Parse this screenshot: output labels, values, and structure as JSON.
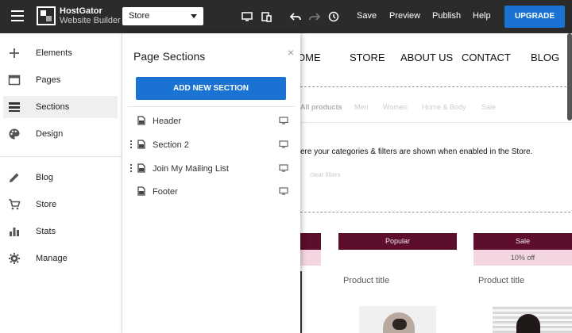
{
  "app": {
    "brand_line1": "HostGator",
    "brand_line2": "Website Builder",
    "page_select": "Store"
  },
  "toolbar": {
    "save": "Save",
    "preview": "Preview",
    "publish": "Publish",
    "help": "Help",
    "upgrade": "UPGRADE",
    "icons": [
      "desktop-icon",
      "mobile-icon",
      "undo-icon",
      "redo-icon",
      "history-icon"
    ]
  },
  "leftnav": {
    "items": [
      {
        "label": "Elements",
        "icon": "plus-icon"
      },
      {
        "label": "Pages",
        "icon": "browser-icon"
      },
      {
        "label": "Sections",
        "icon": "sections-icon",
        "active": true
      },
      {
        "label": "Design",
        "icon": "palette-icon"
      },
      {
        "label": "Blog",
        "icon": "pencil-icon"
      },
      {
        "label": "Store",
        "icon": "cart-icon"
      },
      {
        "label": "Stats",
        "icon": "bar-chart-icon"
      },
      {
        "label": "Manage",
        "icon": "gear-icon"
      }
    ]
  },
  "panel": {
    "title": "Page Sections",
    "close": "×",
    "add_button": "ADD NEW SECTION",
    "sections": [
      {
        "label": "Header",
        "draggable": false
      },
      {
        "label": "Section 2",
        "draggable": true
      },
      {
        "label": "Join My Mailing List",
        "draggable": true
      },
      {
        "label": "Footer",
        "draggable": false
      }
    ]
  },
  "site": {
    "nav": [
      "OME",
      "STORE",
      "ABOUT US",
      "CONTACT",
      "BLOG"
    ],
    "filters": [
      "All products",
      "Men",
      "Women",
      "Home & Body",
      "Sale"
    ],
    "categories_text": "ere your categories & filters are shown when enabled in the Store.",
    "clear_filters": "clear filters",
    "products": [
      {
        "badge": "",
        "discount": "",
        "title": ""
      },
      {
        "badge": "Popular",
        "discount": "",
        "title": "Product title"
      },
      {
        "badge": "Sale",
        "discount": "10% off",
        "title": "Product title"
      }
    ],
    "colors": {
      "badge": "#5c0e2c",
      "discount": "#f3d6e2",
      "accent": "#1a73d2",
      "topbar": "#2b2b2b"
    }
  }
}
